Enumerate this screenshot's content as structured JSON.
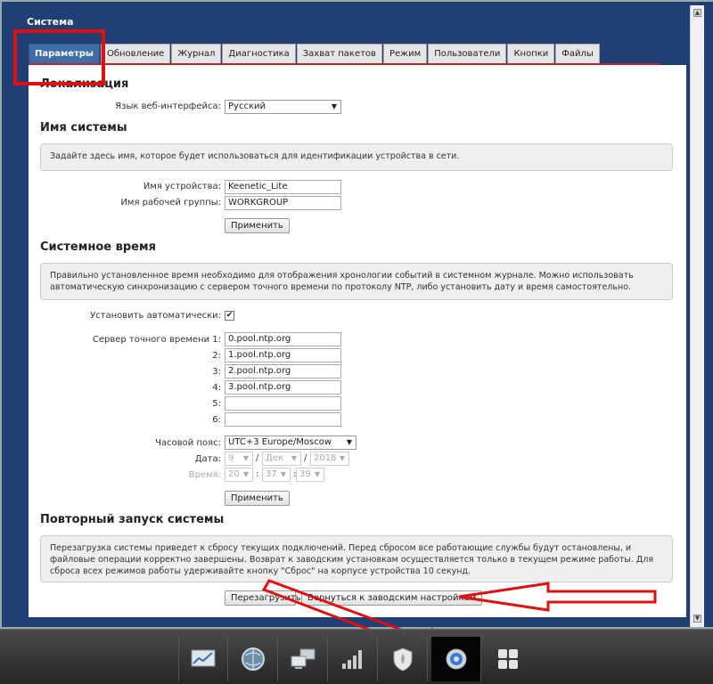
{
  "window": {
    "title": "Система"
  },
  "tabs": [
    "Параметры",
    "Обновление",
    "Журнал",
    "Диагностика",
    "Захват пакетов",
    "Режим",
    "Пользователи",
    "Кнопки",
    "Файлы"
  ],
  "active_tab": "Параметры",
  "localization": {
    "heading": "Локализация",
    "lang_label": "Язык веб-интерфейса:",
    "lang_value": "Русский"
  },
  "system_name": {
    "heading": "Имя системы",
    "info": "Задайте здесь имя, которое будет использоваться для идентификации устройства в сети.",
    "device_label": "Имя устройства:",
    "device_value": "Keenetic_Lite",
    "workgroup_label": "Имя рабочей группы:",
    "workgroup_value": "WORKGROUP",
    "apply": "Применить"
  },
  "system_time": {
    "heading": "Системное время",
    "info": "Правильно установленное время необходимо для отображения хронологии событий в системном журнале. Можно использовать автоматическую синхронизацию с сервером точного времени по протоколу NTP, либо установить дату и время самостоятельно.",
    "auto_label": "Установить автоматически:",
    "auto_checked": true,
    "ntp_label": "Сервер точного времени 1:",
    "ntp_labels": [
      "2:",
      "3:",
      "4:",
      "5:",
      "6:"
    ],
    "ntp_servers": [
      "0.pool.ntp.org",
      "1.pool.ntp.org",
      "2.pool.ntp.org",
      "3.pool.ntp.org",
      "",
      ""
    ],
    "tz_label": "Часовой пояс:",
    "tz_value": "UTC+3 Europe/Moscow",
    "date_label": "Дата:",
    "date_day": "9",
    "date_month": "Дек",
    "date_year": "2018",
    "time_label": "Время:",
    "time_h": "20",
    "time_m": "37",
    "time_s": "39",
    "sep": "/",
    "time_sep": ":",
    "apply": "Применить"
  },
  "reboot": {
    "heading": "Повторный запуск системы",
    "info": "Перезагрузка системы приведет к сбросу текущих подключений. Перед сбросом все работающие службы будут остановлены, и файловые операции корректно завершены. Возврат к заводским установкам осуществляется только в текущем режиме работы. Для сброса всех режимов работы удерживайте кнопку \"Сброс\" на корпусе устройства 10 секунд.",
    "reboot_btn": "Перезагрузить",
    "factory_btn": "Вернуться к заводским настройкам"
  },
  "taskbar": {
    "icons": [
      "monitor-chart-icon",
      "globe-icon",
      "network-computers-icon",
      "wifi-signal-bars-icon",
      "shield-icon",
      "gear-icon",
      "apps-grid-icon"
    ],
    "active": "gear-icon"
  },
  "colors": {
    "header_bg": "#1f3f75",
    "active_tab": "#3d6fa6",
    "annotation_red": "#e01010"
  }
}
